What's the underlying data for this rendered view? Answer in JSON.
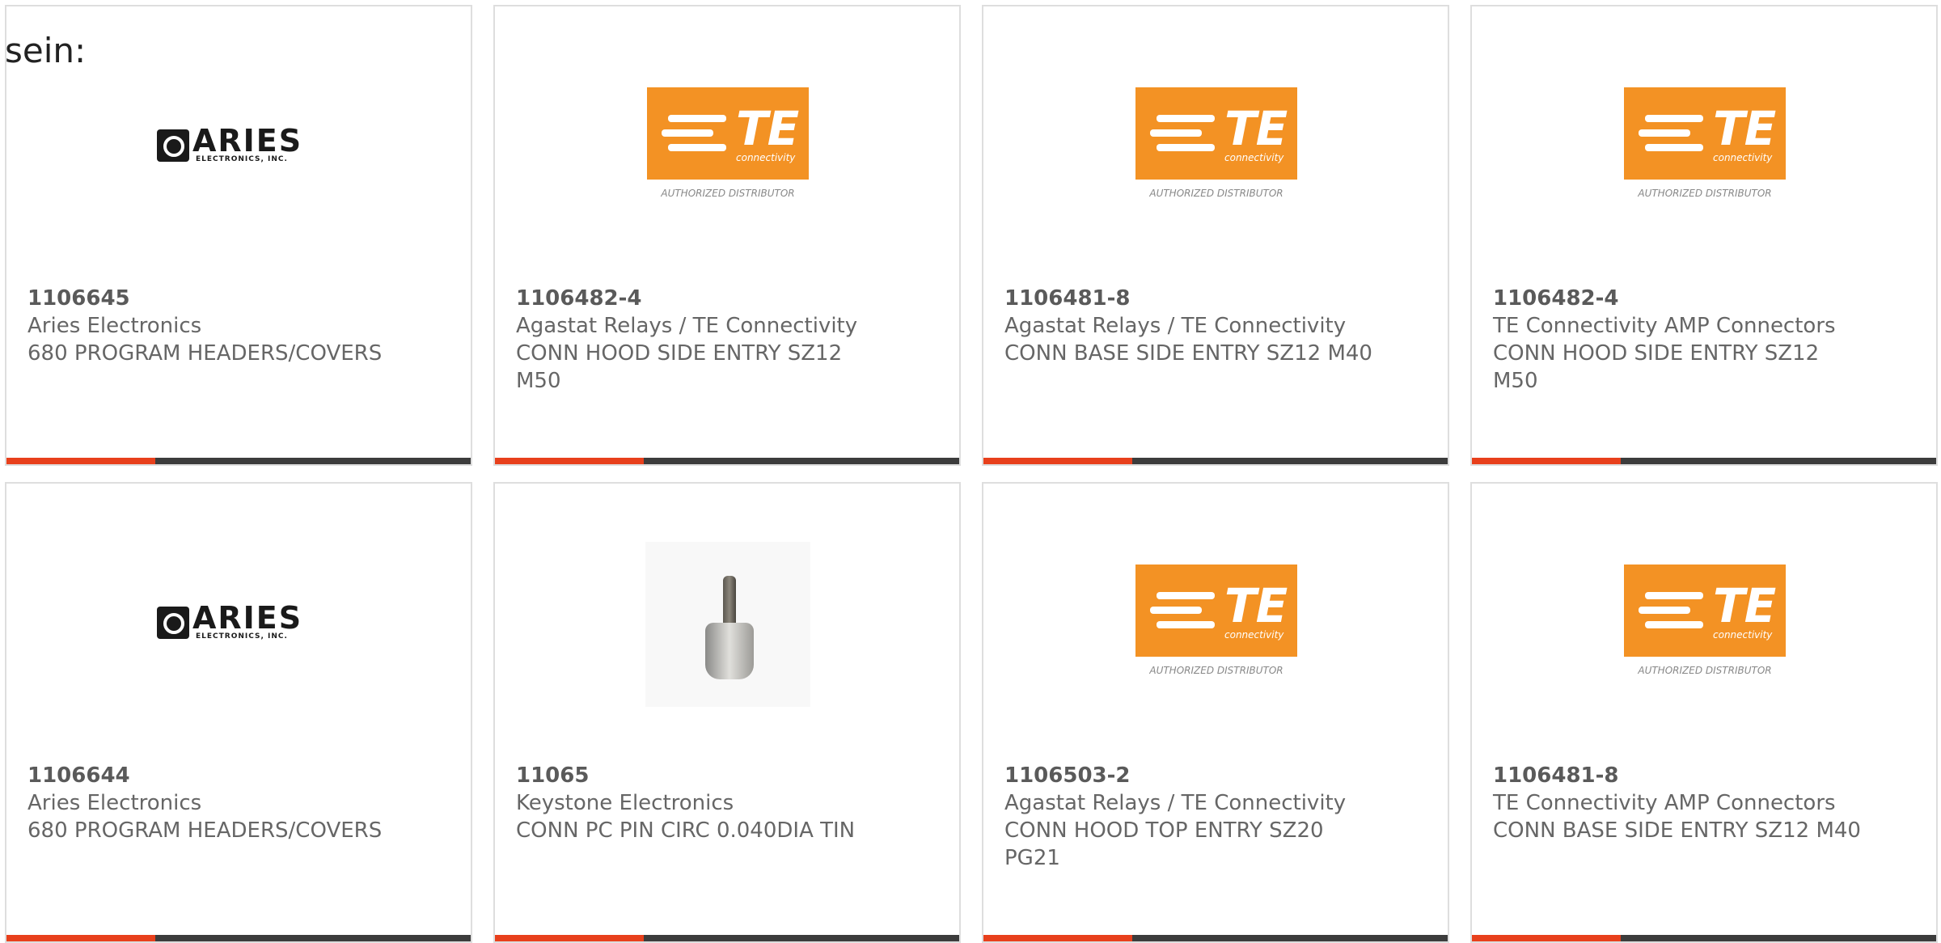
{
  "intro_text": "sein:",
  "accent_color": "#e8401c",
  "bar_color": "#3c3c3c",
  "te_logo": {
    "wordmark": "TE",
    "tagline": "connectivity",
    "caption": "AUTHORIZED DISTRIBUTOR",
    "color": "#f39224"
  },
  "aries_logo": {
    "wordmark": "ARIES",
    "tagline": "ELECTRONICS, INC."
  },
  "products": [
    {
      "logo": "aries-logo",
      "part_number": "1106645",
      "manufacturer": "Aries Electronics",
      "description": "680 PROGRAM HEADERS/COVERS"
    },
    {
      "logo": "te-logo",
      "part_number": "1106482-4",
      "manufacturer": "Agastat Relays / TE Connectivity",
      "description": "CONN HOOD SIDE ENTRY SZ12 M50"
    },
    {
      "logo": "te-logo",
      "part_number": "1106481-8",
      "manufacturer": "Agastat Relays / TE Connectivity",
      "description": "CONN BASE SIDE ENTRY SZ12 M40"
    },
    {
      "logo": "te-logo",
      "part_number": "1106482-4",
      "manufacturer": "TE Connectivity AMP Connectors",
      "description": "CONN HOOD SIDE ENTRY SZ12 M50"
    },
    {
      "logo": "aries-logo",
      "part_number": "1106644",
      "manufacturer": "Aries Electronics",
      "description": "680 PROGRAM HEADERS/COVERS"
    },
    {
      "logo": "pin-photo",
      "part_number": "11065",
      "manufacturer": "Keystone Electronics",
      "description": "CONN PC PIN CIRC 0.040DIA TIN"
    },
    {
      "logo": "te-logo",
      "part_number": "1106503-2",
      "manufacturer": "Agastat Relays / TE Connectivity",
      "description": "CONN HOOD TOP ENTRY SZ20 PG21"
    },
    {
      "logo": "te-logo",
      "part_number": "1106481-8",
      "manufacturer": "TE Connectivity AMP Connectors",
      "description": "CONN BASE SIDE ENTRY SZ12 M40"
    }
  ]
}
